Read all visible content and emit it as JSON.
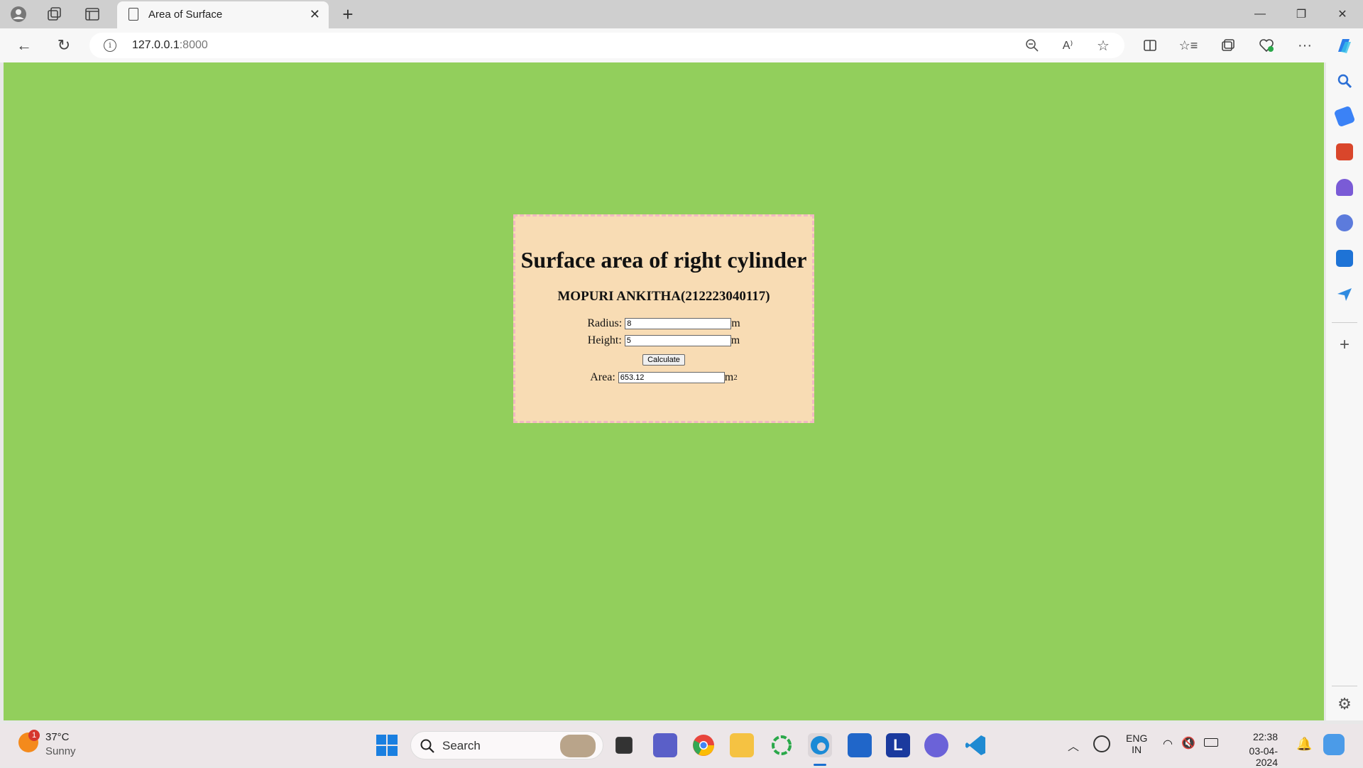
{
  "browser": {
    "tab_title": "Area of Surface",
    "url_host": "127.0.0.1",
    "url_port": ":8000",
    "add_tab": "+"
  },
  "page": {
    "heading": "Surface area of right cylinder",
    "author": "MOPURI ANKITHA(212223040117)",
    "radius_label": "Radius:",
    "radius_value": "8",
    "radius_unit": "m",
    "height_label": "Height:",
    "height_value": "5",
    "height_unit": "m",
    "calculate_label": "Calculate",
    "area_label": "Area:",
    "area_value": "653.12",
    "area_unit": "m",
    "area_unit_sup": "2"
  },
  "taskbar": {
    "weather_temp": "37°C",
    "weather_desc": "Sunny",
    "weather_badge": "1",
    "search_label": "Search",
    "lang_top": "ENG",
    "lang_bottom": "IN",
    "time": "22:38",
    "date": "03-04-2024"
  },
  "colors": {
    "page_bg": "#92cf5c",
    "card_bg": "#f8dcb4",
    "card_border": "#f2b8c2"
  }
}
